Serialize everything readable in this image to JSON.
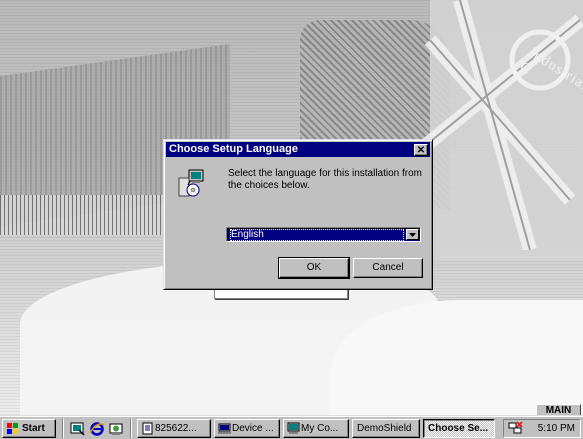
{
  "desktop": {
    "map_label": "Industrial C",
    "main_tab_label": "MAIN"
  },
  "dialog": {
    "title": "Choose Setup Language",
    "close_glyph": "✕",
    "message": "Select the language for this installation from the choices below.",
    "language": {
      "selected": "English"
    },
    "ok_label": "OK",
    "cancel_label": "Cancel",
    "icon": "setup-computer-icon"
  },
  "taskbar": {
    "start_label": "Start",
    "quick_launch": [
      "desktop-icon",
      "internet-explorer-icon",
      "channels-icon"
    ],
    "buttons": [
      {
        "label": "825622...",
        "icon": "document-icon",
        "active": false
      },
      {
        "label": "Device ...",
        "icon": "device-manager-icon",
        "active": false
      },
      {
        "label": "My Co...",
        "icon": "my-computer-icon",
        "active": false
      },
      {
        "label": "DemoShield",
        "icon": "",
        "active": false
      },
      {
        "label": "Choose Se...",
        "icon": "",
        "active": true
      }
    ],
    "tray_icon": "network-icon",
    "clock": "5:10 PM"
  },
  "colors": {
    "titlebar": "#000080",
    "face": "#c0c0c0",
    "selection": "#000080"
  }
}
